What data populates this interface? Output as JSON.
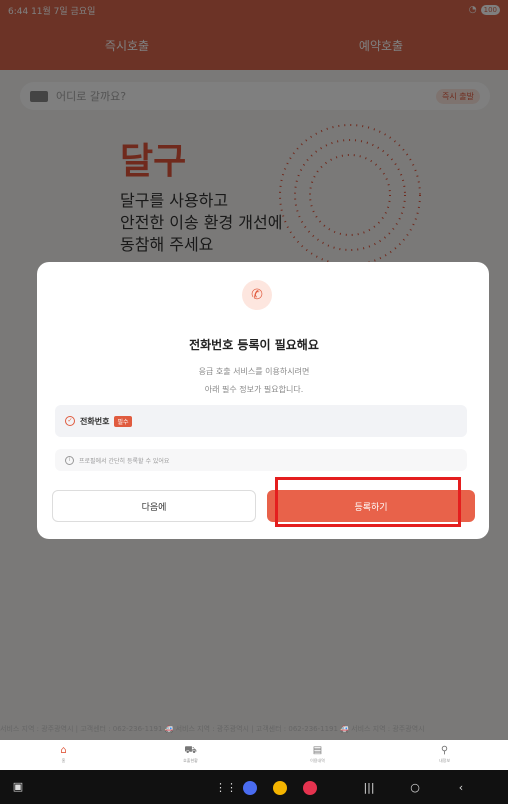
{
  "status_bar": {
    "time": "6:44 11월 7일 금요일",
    "battery": "100"
  },
  "tabs": [
    {
      "label": "즉시호출"
    },
    {
      "label": "예약호출"
    }
  ],
  "search": {
    "placeholder": "어디로 갈까요?",
    "badge": "즉시 출발"
  },
  "hero": {
    "title": "달구",
    "subtitle": "달구를 사용하고\n안전한 이송 환경 개선에\n동참해 주세요"
  },
  "modal": {
    "title": "전화번호 등록이 필요해요",
    "description": "응급 호출 서비스를 이용하시려면\n아래 필수 정보가 필요합니다.",
    "requirement": {
      "label": "전화번호",
      "badge": "필수"
    },
    "info": "프로필에서 간단히 등록할 수 있어요",
    "later_label": "다음에",
    "register_label": "등록하기"
  },
  "footer_marquee": "서비스 지역 : 광주광역시 | 고객센터 : 062-236-1191     🚑 서비스 지역 : 광주광역시 | 고객센터 : 062-236-1191     🚑 서비스 지역 : 광주광역시",
  "bottom_nav": [
    {
      "label": "홈",
      "icon": "home-icon",
      "glyph": "⌂"
    },
    {
      "label": "호출현황",
      "icon": "truck-icon",
      "glyph": "⛟"
    },
    {
      "label": "이용내역",
      "icon": "document-icon",
      "glyph": "▤"
    },
    {
      "label": "내정보",
      "icon": "person-icon",
      "glyph": "⚲"
    }
  ],
  "colors": {
    "brand": "#d9674d",
    "accent": "#e05b3f",
    "highlight": "#e41e1e"
  }
}
